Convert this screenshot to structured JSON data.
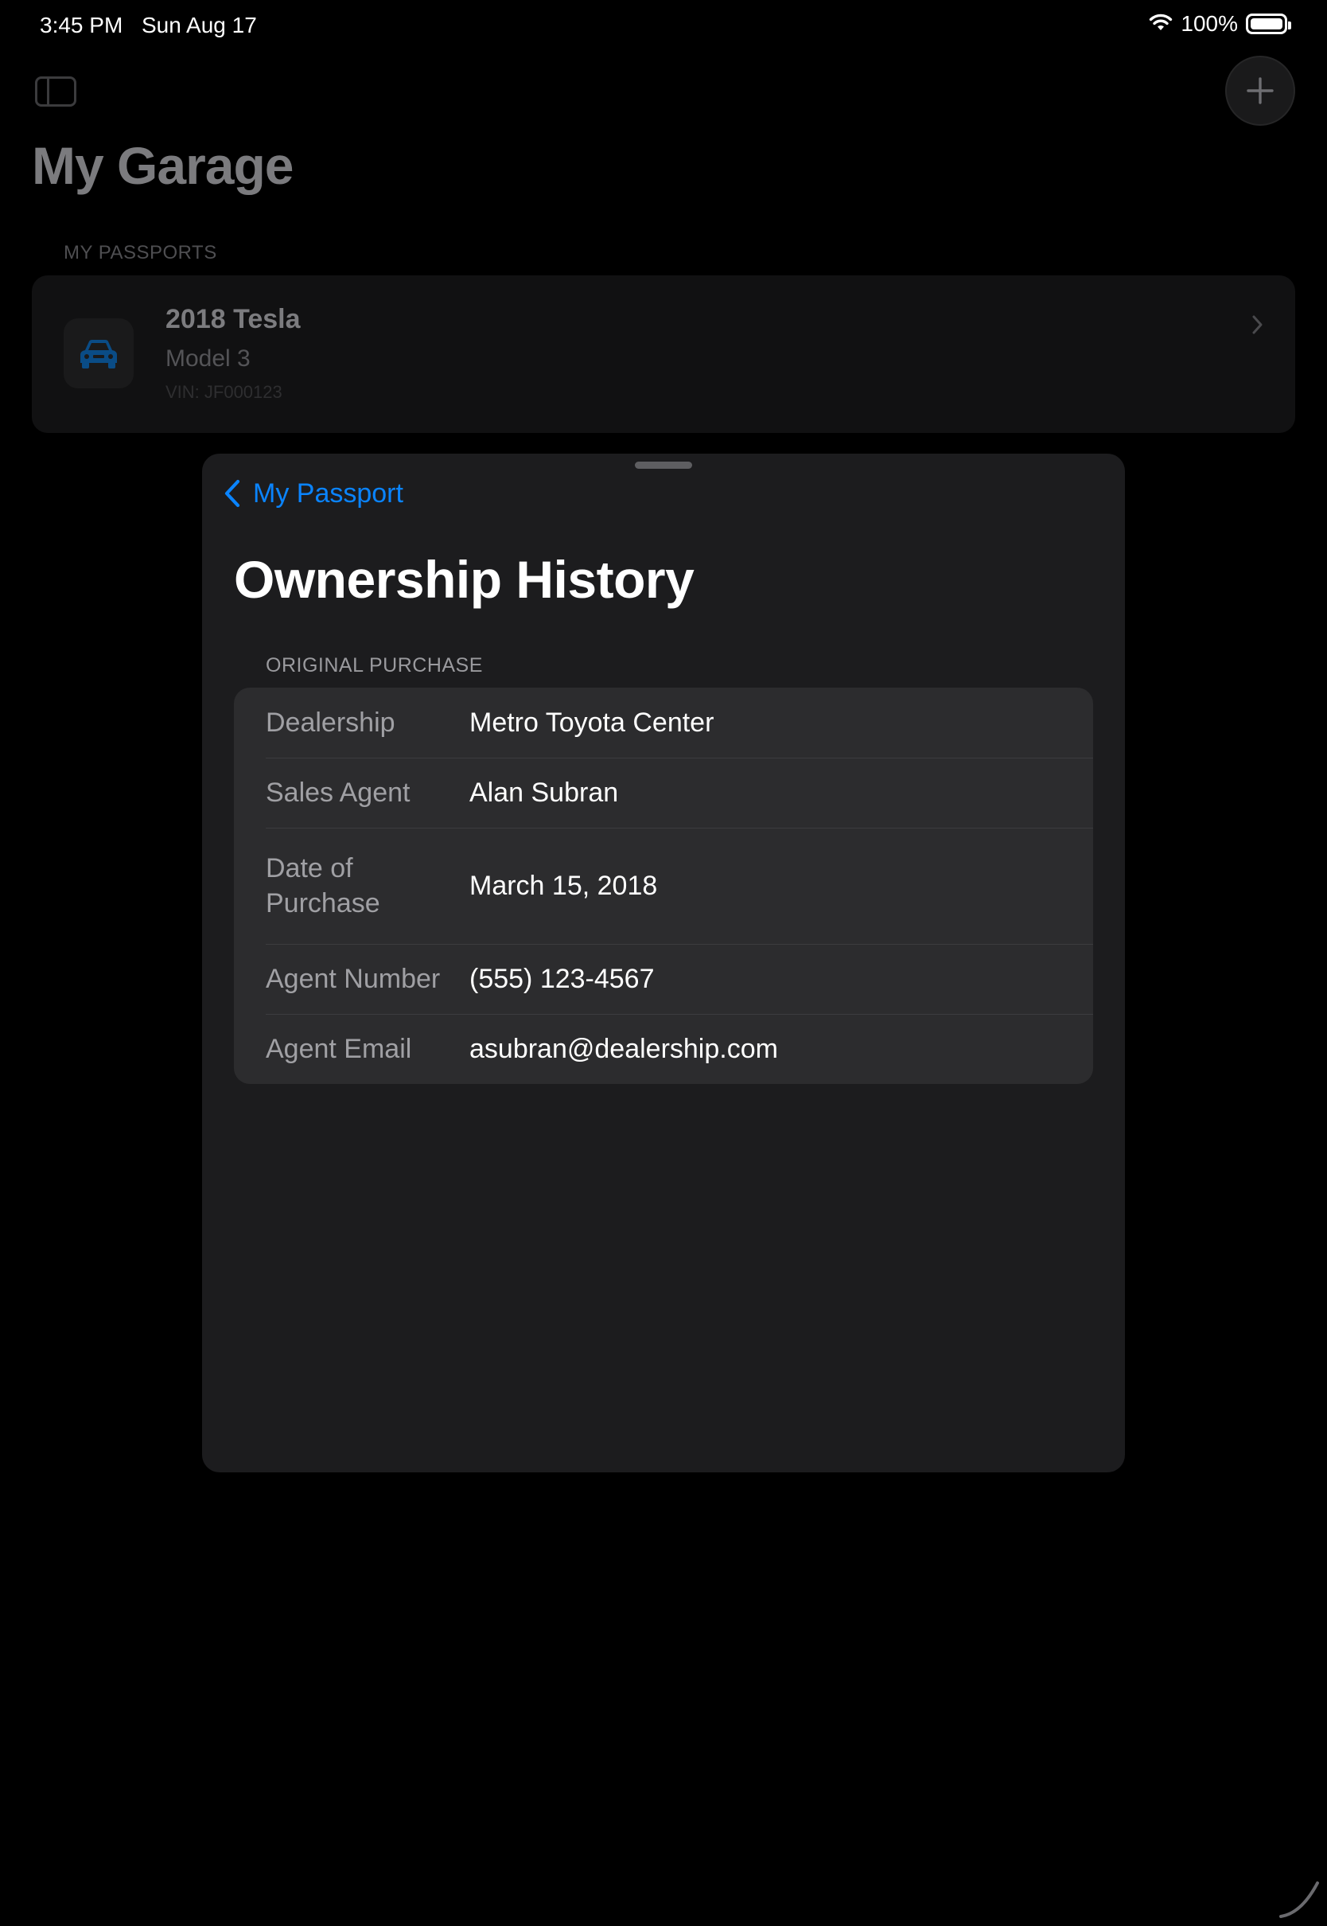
{
  "status_bar": {
    "time": "3:45 PM",
    "date": "Sun Aug 17",
    "battery_pct": "100%",
    "wifi_icon": "wifi-icon",
    "battery_icon": "battery-icon"
  },
  "background": {
    "sidebar_icon": "sidebar-icon",
    "add_icon": "plus-icon",
    "title": "My Garage",
    "section_label": "MY PASSPORTS",
    "passport": {
      "icon": "car-icon",
      "title": "2018 Tesla",
      "model": "Model 3",
      "vin": "VIN: JF000123",
      "chevron_icon": "chevron-right-icon"
    }
  },
  "sheet": {
    "back_label": "My Passport",
    "back_icon": "chevron-left-icon",
    "title": "Ownership History",
    "section_label": "ORIGINAL PURCHASE",
    "rows": [
      {
        "label": "Dealership",
        "value": "Metro Toyota Center"
      },
      {
        "label": "Sales Agent",
        "value": "Alan Subran"
      },
      {
        "label": "Date of Purchase",
        "value": "March 15, 2018"
      },
      {
        "label": "Agent Number",
        "value": "(555) 123-4567"
      },
      {
        "label": "Agent Email",
        "value": "asubran@dealership.com"
      }
    ]
  },
  "colors": {
    "accent": "#0a84ff",
    "sheet_bg": "#1c1c1e",
    "group_bg": "#2c2c2e",
    "page_bg": "#000000"
  }
}
